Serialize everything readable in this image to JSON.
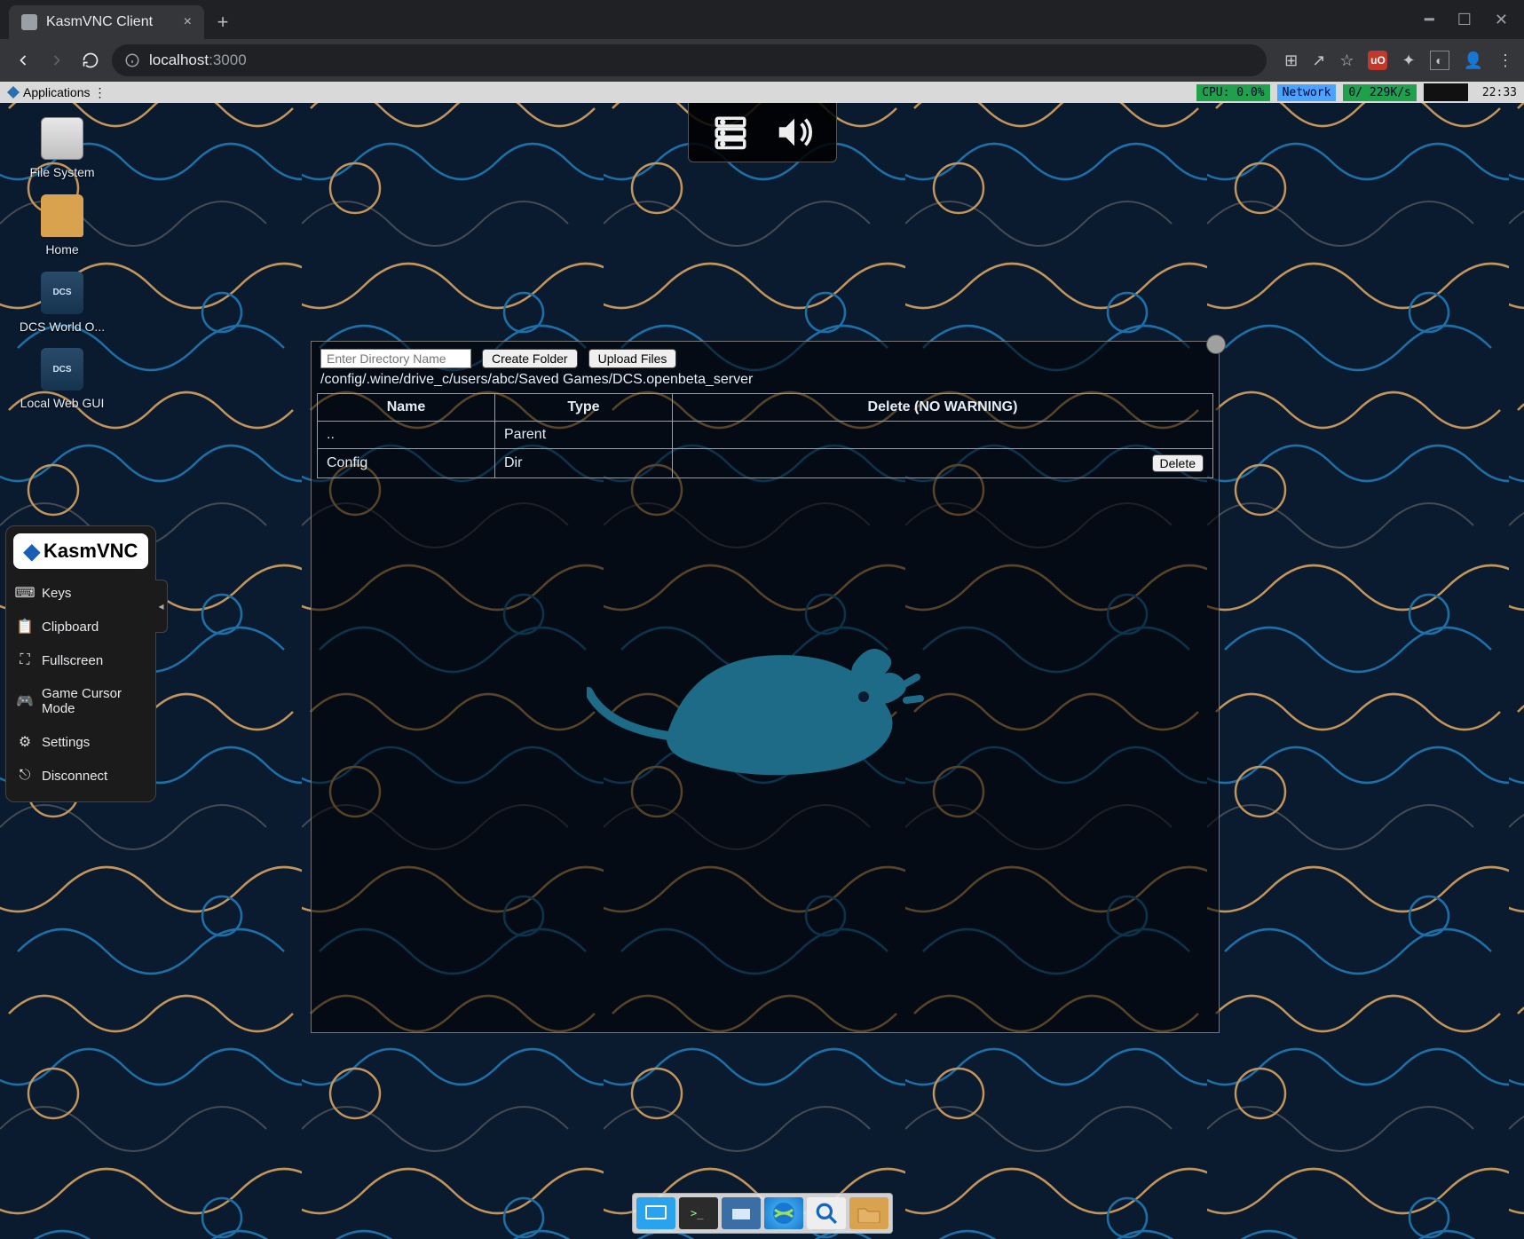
{
  "browser": {
    "tab_title": "KasmVNC Client",
    "url_host": "localhost",
    "url_port": ":3000",
    "omnibox_info_icon": "info-icon"
  },
  "xfce": {
    "applications_label": "Applications",
    "stats_cpu": "CPU:   0.0%",
    "stats_net_label": "Network",
    "stats_net_value": "0/   229K/s",
    "clock": "22:33"
  },
  "desktop": {
    "file_system": "File System",
    "home": "Home",
    "dcs_world": "DCS World O...",
    "dcs_badge": "DCS",
    "local_web_gui": "Local Web GUI"
  },
  "kasm": {
    "logo_text": "KasmVNC",
    "items": {
      "keys": "Keys",
      "clipboard": "Clipboard",
      "fullscreen": "Fullscreen",
      "game_cursor": "Game Cursor Mode",
      "settings": "Settings",
      "disconnect": "Disconnect"
    }
  },
  "fm": {
    "dir_input_placeholder": "Enter Directory Name",
    "create_folder": "Create Folder",
    "upload_files": "Upload Files",
    "path": "/config/.wine/drive_c/users/abc/Saved Games/DCS.openbeta_server",
    "headers": {
      "name": "Name",
      "type": "Type",
      "delete": "Delete (NO WARNING)"
    },
    "rows": {
      "parent": {
        "name": "..",
        "type": "Parent"
      },
      "config": {
        "name": "Config",
        "type": "Dir",
        "delete": "Delete"
      }
    }
  }
}
